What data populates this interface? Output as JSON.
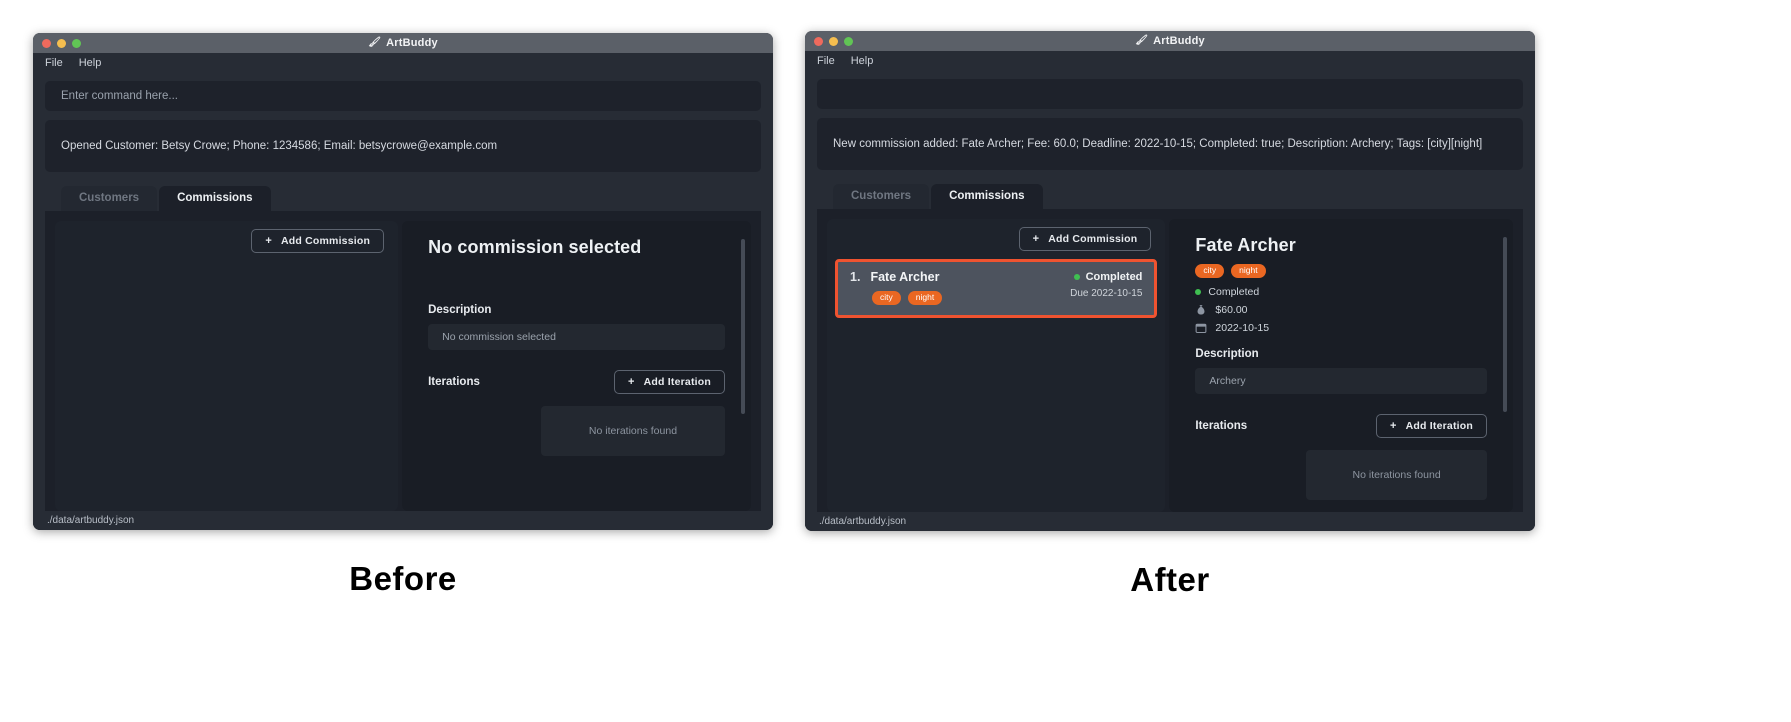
{
  "window_title": "ArtBuddy",
  "app_icon": "artbuddy-logo-icon",
  "menu": {
    "file": "File",
    "help": "Help"
  },
  "before": {
    "caption": "Before",
    "command_input": {
      "value": "",
      "placeholder": "Enter command here..."
    },
    "log": "Opened Customer: Betsy Crowe; Phone: 1234586; Email: betsycrowe@example.com",
    "tabs": [
      {
        "label": "Customers",
        "active": false
      },
      {
        "label": "Commissions",
        "active": true
      }
    ],
    "add_commission_button": "Add Commission",
    "plus": "+",
    "commissions": [],
    "detail": {
      "title": "No commission selected",
      "description_label": "Description",
      "description_value": "No commission selected",
      "iterations_label": "Iterations",
      "add_iteration_button": "Add Iteration",
      "empty_iterations": "No iterations found"
    },
    "statusbar": "./data/artbuddy.json"
  },
  "after": {
    "caption": "After",
    "command_input": {
      "value": "",
      "placeholder": ""
    },
    "log": "New commission added: Fate Archer; Fee: 60.0; Deadline: 2022-10-15; Completed: true; Description: Archery; Tags: [city][night]",
    "tabs": [
      {
        "label": "Customers",
        "active": false
      },
      {
        "label": "Commissions",
        "active": true
      }
    ],
    "add_commission_button": "Add Commission",
    "plus": "+",
    "commission_row": {
      "index": "1.",
      "title": "Fate Archer",
      "tags": [
        "city",
        "night"
      ],
      "status": "Completed",
      "due": "Due 2022-10-15"
    },
    "detail": {
      "title": "Fate Archer",
      "tags": [
        "city",
        "night"
      ],
      "status": "Completed",
      "fee": "$60.00",
      "deadline": "2022-10-15",
      "fee_icon": "money-bag-icon",
      "deadline_icon": "calendar-icon",
      "description_label": "Description",
      "description_value": "Archery",
      "iterations_label": "Iterations",
      "add_iteration_button": "Add Iteration",
      "empty_iterations": "No iterations found"
    },
    "statusbar": "./data/artbuddy.json"
  },
  "colors": {
    "accent_orange": "#ea6722",
    "highlight_border": "#ef5330",
    "status_green": "#3fbf51",
    "window_bg": "#272c35",
    "panel_bg": "#1c2029"
  }
}
